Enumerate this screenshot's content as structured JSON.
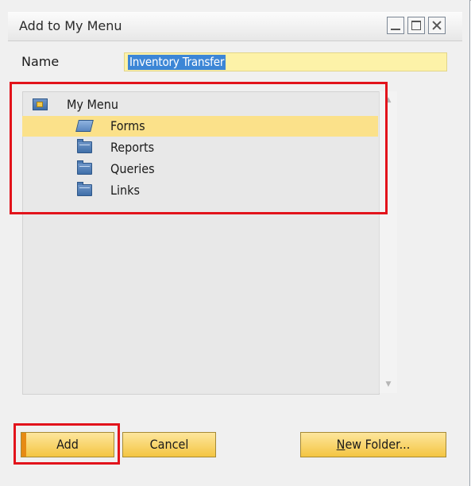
{
  "window": {
    "title": "Add to My Menu",
    "controls": [
      "minimize",
      "maximize",
      "close"
    ]
  },
  "name_field": {
    "label": "Name",
    "value": "Inventory Transfer",
    "selected": true
  },
  "tree": {
    "root": {
      "label": "My Menu",
      "icon": "my-menu-icon"
    },
    "items": [
      {
        "label": "Forms",
        "icon": "open-folder-icon",
        "selected": true
      },
      {
        "label": "Reports",
        "icon": "folder-icon",
        "selected": false
      },
      {
        "label": "Queries",
        "icon": "folder-icon",
        "selected": false
      },
      {
        "label": "Links",
        "icon": "folder-icon",
        "selected": false
      }
    ]
  },
  "buttons": {
    "add": "Add",
    "cancel": "Cancel",
    "new_folder_mnemonic": "N",
    "new_folder_rest": "ew Folder..."
  },
  "colors": {
    "selection_row": "#fbe18a",
    "name_field_bg": "#fdf2a8",
    "text_selection": "#3c86d6",
    "button": "#f4c542",
    "highlight_box": "#e2131b"
  }
}
